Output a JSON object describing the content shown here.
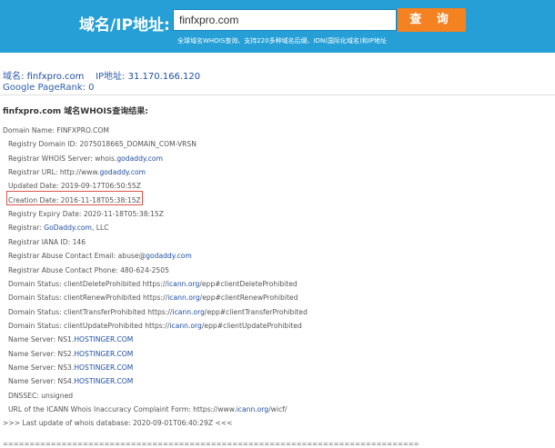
{
  "header": {
    "brand": "域名/IP地址:",
    "search_value": "finfxpro.com",
    "query_button": "查 询",
    "subtitle": "全球域名WHOIS查询、支持220多种域名后缀、IDN(国际化域名)和IP地址",
    "bg_color": "#259fd6",
    "button_color": "#f58220"
  },
  "info": {
    "domain_label": "域名:",
    "domain_value": "finfxpro.com",
    "ip_label": "IP地址:",
    "ip_value": "31.170.166.120",
    "pagerank": "Google PageRank: 0"
  },
  "result": {
    "title": "finfxpro.com 域名WHOIS查询结果:",
    "lines": [
      {
        "pre": "Domain Name: FINFXPRO.COM",
        "link": "",
        "post": ""
      },
      {
        "pre": "Registry Domain ID: 2075018665_DOMAIN_COM-VRSN",
        "link": "",
        "post": ""
      },
      {
        "pre": "Registrar WHOIS Server: whois.",
        "link": "godaddy.com",
        "post": ""
      },
      {
        "pre": "Registrar URL: http://www.",
        "link": "godaddy.com",
        "post": ""
      },
      {
        "pre": "Updated Date: 2019-09-17T06:50:55Z",
        "link": "",
        "post": ""
      },
      {
        "pre": "Creation Date: 2016-11-18T05:38:15Z",
        "link": "",
        "post": ""
      },
      {
        "pre": "Registry Expiry Date: 2020-11-18T05:38:15Z",
        "link": "",
        "post": ""
      },
      {
        "pre": "Registrar: ",
        "link": "GoDaddy.com",
        "post": ", LLC"
      },
      {
        "pre": "Registrar IANA ID: 146",
        "link": "",
        "post": ""
      },
      {
        "pre": "Registrar Abuse Contact Email: abuse@",
        "link": "godaddy.com",
        "post": ""
      },
      {
        "pre": "Registrar Abuse Contact Phone: 480-624-2505",
        "link": "",
        "post": ""
      },
      {
        "pre": "Domain Status: clientDeleteProhibited https://",
        "link": "icann.org",
        "post": "/epp#clientDeleteProhibited"
      },
      {
        "pre": "Domain Status: clientRenewProhibited https://",
        "link": "icann.org",
        "post": "/epp#clientRenewProhibited"
      },
      {
        "pre": "Domain Status: clientTransferProhibited https://",
        "link": "icann.org",
        "post": "/epp#clientTransferProhibited"
      },
      {
        "pre": "Domain Status: clientUpdateProhibited https://",
        "link": "icann.org",
        "post": "/epp#clientUpdateProhibited"
      },
      {
        "pre": "Name Server: NS1.",
        "link": "HOSTINGER.COM",
        "post": ""
      },
      {
        "pre": "Name Server: NS2.",
        "link": "HOSTINGER.COM",
        "post": ""
      },
      {
        "pre": "Name Server: NS3.",
        "link": "HOSTINGER.COM",
        "post": ""
      },
      {
        "pre": "Name Server: NS4.",
        "link": "HOSTINGER.COM",
        "post": ""
      },
      {
        "pre": "DNSSEC: unsigned",
        "link": "",
        "post": ""
      },
      {
        "pre": "URL of the ICANN Whois Inaccuracy Complaint Form: https://www.",
        "link": "icann.org",
        "post": "/wicf/"
      },
      {
        "pre": ">>> Last update of whois database: 2020-09-01T06:40:29Z <<<",
        "link": "",
        "post": ""
      }
    ],
    "separator": "=============================================================================="
  }
}
